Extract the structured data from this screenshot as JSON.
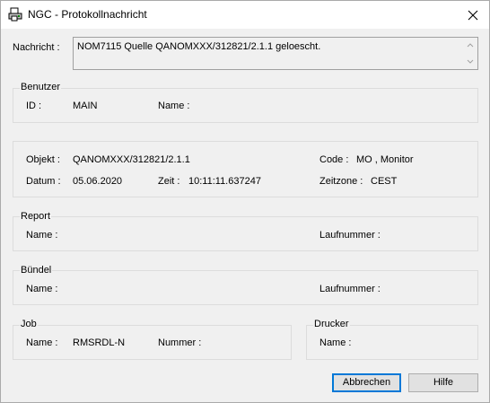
{
  "window": {
    "title": "NGC - Protokollnachricht",
    "icon": "printer-document-icon",
    "close_icon": "close-icon"
  },
  "message": {
    "label": "Nachricht :",
    "value": "NOM7115 Quelle QANOMXXX/312821/2.1.1 geloescht."
  },
  "benutzer": {
    "legend": "Benutzer",
    "id_label": "ID :",
    "id_value": "MAIN",
    "name_label": "Name :",
    "name_value": ""
  },
  "objekt": {
    "objekt_label": "Objekt :",
    "objekt_value": "QANOMXXX/312821/2.1.1",
    "code_label": "Code :",
    "code_value": "MO , Monitor",
    "datum_label": "Datum :",
    "datum_value": "05.06.2020",
    "zeit_label": "Zeit :",
    "zeit_value": "10:11:11.637247",
    "zeitzone_label": "Zeitzone :",
    "zeitzone_value": "CEST"
  },
  "report": {
    "legend": "Report",
    "name_label": "Name :",
    "laufnummer_label": "Laufnummer :"
  },
  "buendel": {
    "legend": "Bündel",
    "name_label": "Name :",
    "laufnummer_label": "Laufnummer :"
  },
  "job": {
    "legend": "Job",
    "name_label": "Name :",
    "name_value": "RMSRDL-N",
    "nummer_label": "Nummer :"
  },
  "drucker": {
    "legend": "Drucker",
    "name_label": "Name :"
  },
  "buttons": {
    "abbrechen": "Abbrechen",
    "hilfe": "Hilfe"
  },
  "colors": {
    "dialog_bg": "#f0f0f0",
    "default_button_border": "#0078d7"
  }
}
